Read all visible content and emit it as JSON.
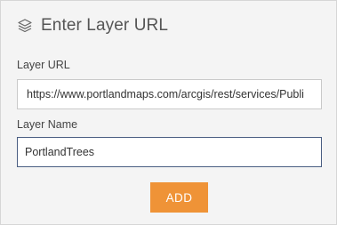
{
  "header": {
    "icon": "layers-icon",
    "title": "Enter Layer URL"
  },
  "layer_url": {
    "label": "Layer URL",
    "value": "https://www.portlandmaps.com/arcgis/rest/services/Publi"
  },
  "layer_name": {
    "label": "Layer Name",
    "value": "PortlandTrees"
  },
  "actions": {
    "add_label": "ADD"
  },
  "colors": {
    "accent_button": "#ef9337",
    "focused_border": "#4a5e82",
    "panel_background": "#f4f4f4"
  }
}
